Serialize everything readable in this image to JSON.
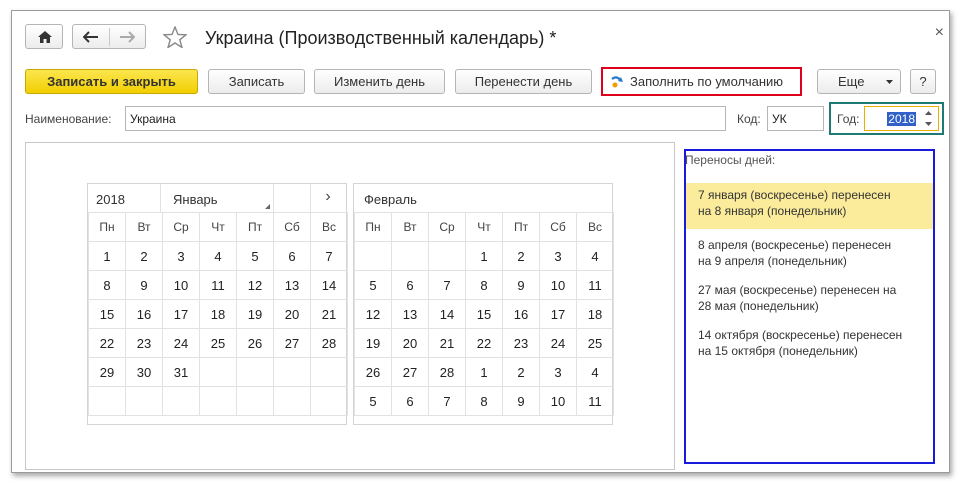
{
  "window": {
    "title": "Украина (Производственный календарь) *",
    "close_glyph": "×"
  },
  "toolbar": {
    "save_close": "Записать и закрыть",
    "save": "Записать",
    "change_day": "Изменить день",
    "move_day": "Перенести день",
    "fill_default": "Заполнить по умолчанию",
    "more": "Еще",
    "help": "?"
  },
  "form": {
    "name_label": "Наименование:",
    "name_value": "Украина",
    "code_label": "Код:",
    "code_value": "УК",
    "year_label": "Год:",
    "year_value": "2018"
  },
  "calendar": {
    "year": "2018",
    "month_select": "Январь",
    "next_glyph": "›",
    "weekdays": [
      "Пн",
      "Вт",
      "Ср",
      "Чт",
      "Пт",
      "Сб",
      "Вс"
    ],
    "months": [
      {
        "name": "Январь",
        "weeks": [
          [
            "1",
            "2",
            "3",
            "4",
            "5",
            "6",
            "7"
          ],
          [
            "8",
            "9",
            "10",
            "11",
            "12",
            "13",
            "14"
          ],
          [
            "15",
            "16",
            "17",
            "18",
            "19",
            "20",
            "21"
          ],
          [
            "22",
            "23",
            "24",
            "25",
            "26",
            "27",
            "28"
          ],
          [
            "29",
            "30",
            "31",
            "",
            "",
            "",
            ""
          ],
          [
            "",
            "",
            "",
            "",
            "",
            "",
            ""
          ]
        ]
      },
      {
        "name": "Февраль",
        "weeks": [
          [
            "",
            "",
            "",
            "1",
            "2",
            "3",
            "4"
          ],
          [
            "5",
            "6",
            "7",
            "8",
            "9",
            "10",
            "11"
          ],
          [
            "12",
            "13",
            "14",
            "15",
            "16",
            "17",
            "18"
          ],
          [
            "19",
            "20",
            "21",
            "22",
            "23",
            "24",
            "25"
          ],
          [
            "26",
            "27",
            "28",
            "1",
            "2",
            "3",
            "4"
          ],
          [
            "5",
            "6",
            "7",
            "8",
            "9",
            "10",
            "11"
          ]
        ]
      }
    ]
  },
  "transfers": {
    "header": "Переносы дней:",
    "items": [
      {
        "line1": "7 января (воскресенье) перенесен",
        "line2": "на 8 января (понедельник)"
      },
      {
        "line1": "8 апреля (воскресенье) перенесен",
        "line2": "на 9 апреля (понедельник)"
      },
      {
        "line1": "27 мая (воскресенье) перенесен на",
        "line2": "28 мая (понедельник)"
      },
      {
        "line1": "14 октября (воскресенье) перенесен",
        "line2": "на 15 октября (понедельник)"
      }
    ]
  },
  "icons": [
    "home-icon",
    "arrow-left-icon",
    "arrow-right-icon",
    "star-icon",
    "close-icon",
    "fill-default-icon",
    "dropdown-arrow-icon",
    "spin-up-icon",
    "spin-down-icon"
  ],
  "colors": {
    "primary_button": "#f5d400",
    "weekend_header": "#d24a00",
    "holiday": "#c00000",
    "selected_row": "#fbec9c",
    "red_annotation": "#e0001b",
    "green_annotation": "#1e7a72",
    "blue_annotation": "#1a1adc"
  }
}
